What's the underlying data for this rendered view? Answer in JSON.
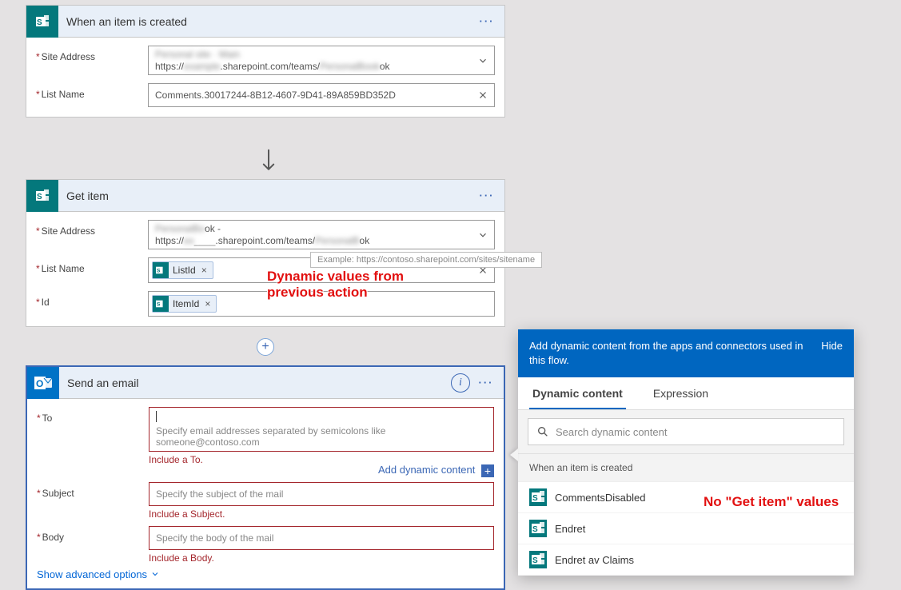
{
  "card1": {
    "title": "When an item is created",
    "siteLabel": "Site Address",
    "siteValue1": "Personal site · Main",
    "siteValue2Prefix": "https://",
    "siteValue2Blur": "example",
    "siteValue2Mid": ".sharepoint.com/teams/",
    "siteValue2Blur2": "PersonalBook",
    "siteValue2Suffix": "ok",
    "listLabel": "List Name",
    "listValue": "Comments.30017244-8B12-4607-9D41-89A859BD352D"
  },
  "card2": {
    "title": "Get item",
    "siteLabel": "Site Address",
    "siteValue1": "PersonalBook -",
    "siteValue2Prefix": "https://",
    "siteValue2Blur": "ex",
    "siteValue2Mid": ".sharepoint.com/teams/",
    "siteValue2Blur2": "PersonalB",
    "siteValue2Suffix": "ok",
    "listLabel": "List Name",
    "idLabel": "Id",
    "tokenList": "ListId",
    "tokenId": "ItemId"
  },
  "tooltip": "Example: https://contoso.sharepoint.com/sites/sitename",
  "annotation1": "Dynamic values from\nprevious action",
  "annotation2": "No \"Get item\" values",
  "card3": {
    "title": "Send an email",
    "toLabel": "To",
    "toPlaceholder": "Specify email addresses separated by semicolons like someone@contoso.com",
    "toError": "Include a To.",
    "addDynamic": "Add dynamic content",
    "subjectLabel": "Subject",
    "subjectPlaceholder": "Specify the subject of the mail",
    "subjectError": "Include a Subject.",
    "bodyLabel": "Body",
    "bodyPlaceholder": "Specify the body of the mail",
    "bodyError": "Include a Body.",
    "advanced": "Show advanced options"
  },
  "dynPanel": {
    "headerText": "Add dynamic content from the apps and connectors used in this flow.",
    "hide": "Hide",
    "tabDynamic": "Dynamic content",
    "tabExpression": "Expression",
    "searchPlaceholder": "Search dynamic content",
    "group1": "When an item is created",
    "items": [
      "CommentsDisabled",
      "Endret",
      "Endret av Claims"
    ]
  }
}
